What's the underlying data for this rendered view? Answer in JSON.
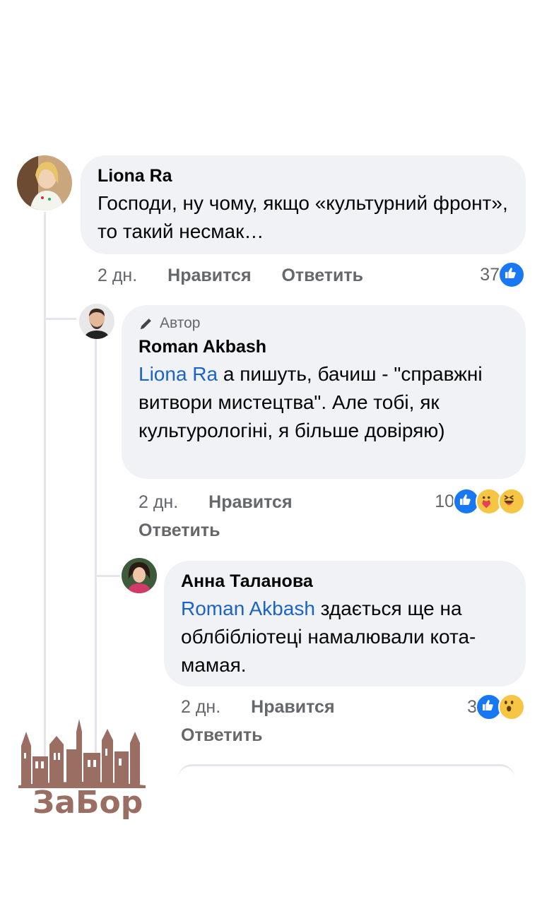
{
  "comments": [
    {
      "author": "Liona Ra",
      "text": "Господи, ну чому, якщо «культурний фронт», то такий несмак…",
      "time": "2 дн.",
      "like_label": "Нравится",
      "reply_label": "Ответить",
      "reaction_count": "37",
      "reactions": [
        "like-icon"
      ]
    },
    {
      "badge": "Автор",
      "author": "Roman Akbash",
      "mention": "Liona Ra",
      "text": " а пишуть, бачиш - \"справжні витвори мистецтва\". Але тобі, як культурологіні, я більше довіряю)",
      "time": "2 дн.",
      "like_label": "Нравится",
      "reply_label": "Ответить",
      "reaction_count": "10",
      "reactions": [
        "like-icon",
        "care-icon",
        "haha-icon"
      ]
    },
    {
      "author": "Анна Таланова",
      "mention": "Roman Akbash",
      "text": " здається ще на облбібліотеці намалювали кота-мамая.",
      "time": "2 дн.",
      "like_label": "Нравится",
      "reply_label": "Ответить",
      "reaction_count": "3",
      "reactions": [
        "like-icon",
        "wow-icon"
      ]
    }
  ],
  "watermark": {
    "text": "ЗаБор"
  },
  "colors": {
    "bubble": "#f0f2f5",
    "mention": "#1b63c8",
    "meta": "#65676b",
    "like": "#1877f2",
    "logo": "#9b6e63"
  }
}
